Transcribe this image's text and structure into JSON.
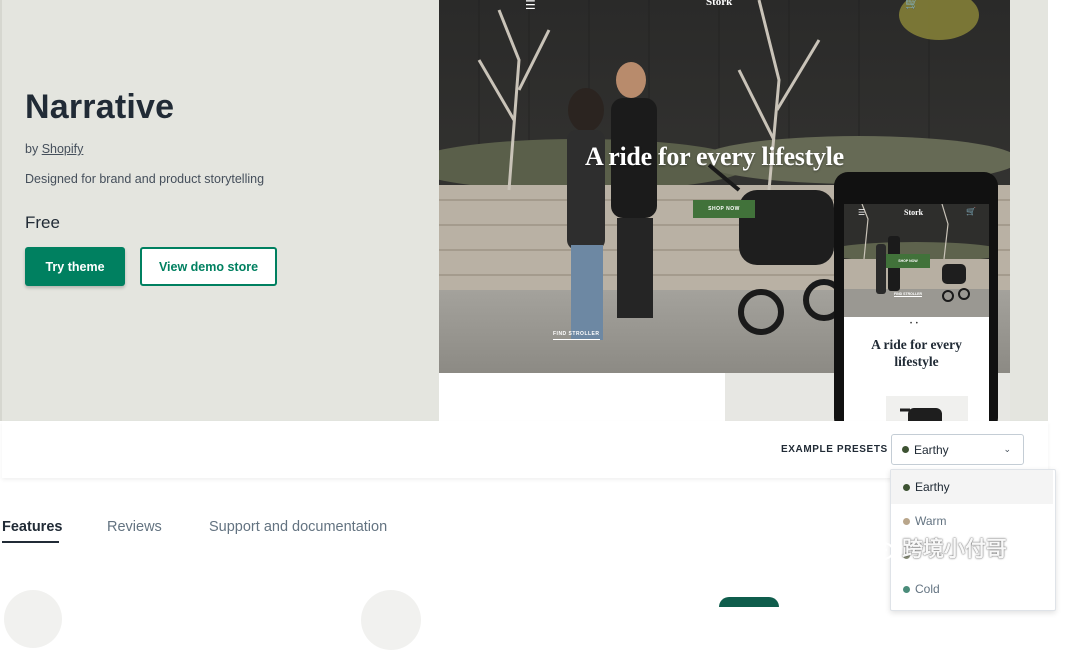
{
  "theme": {
    "name": "Narrative",
    "by_prefix": "by ",
    "author": "Shopify",
    "description": "Designed for brand and product storytelling",
    "price": "Free"
  },
  "buttons": {
    "try_theme": "Try theme",
    "view_demo": "View demo store"
  },
  "desktop_preview": {
    "brand": "Stork",
    "headline": "A ride for every lifestyle",
    "shop_button": "SHOP NOW",
    "caption": "FIND STROLLER"
  },
  "phone_preview": {
    "brand": "Stork",
    "shop_button": "SHOP NOW",
    "caption": "FIND STROLLER",
    "dots": "• •",
    "headline_line1": "A ride for every",
    "headline_line2": "lifestyle"
  },
  "presets": {
    "label": "EXAMPLE PRESETS",
    "selected": "Earthy",
    "options": [
      {
        "label": "Earthy",
        "color": "#3d5232",
        "active": true
      },
      {
        "label": "Warm",
        "color": "#b9a68b",
        "active": false
      },
      {
        "label": "",
        "color": "#8a8f7a",
        "active": false
      },
      {
        "label": "Cold",
        "color": "#4a8c7a",
        "active": false
      }
    ]
  },
  "tabs": [
    {
      "label": "Features",
      "active": true
    },
    {
      "label": "Reviews",
      "active": false
    },
    {
      "label": "Support and documentation",
      "active": false
    }
  ],
  "watermark": {
    "text": "跨境小付哥",
    "icon": "wechat-icon"
  },
  "colors": {
    "brand_green": "#008060",
    "hero_bg": "#e4e5df",
    "text_dark": "#212b36",
    "shop_now_green": "#41723a"
  }
}
